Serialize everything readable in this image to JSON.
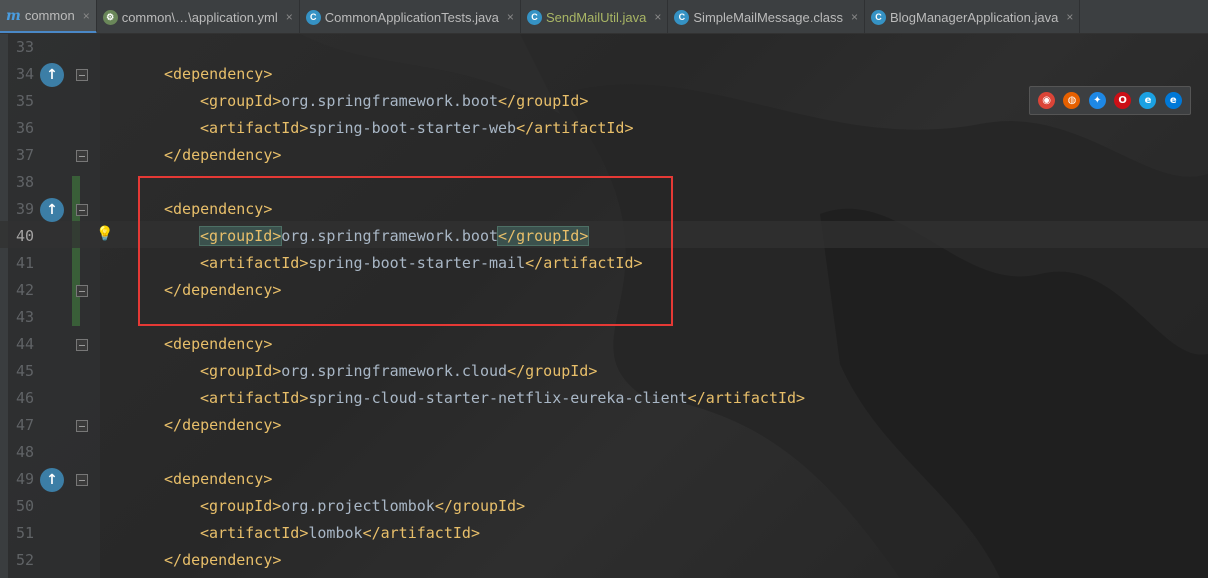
{
  "tabs": [
    {
      "label": "common",
      "icon": "maven-module-icon",
      "closable": true,
      "active": true
    },
    {
      "label": "common\\…\\application.yml",
      "icon": "yaml-file-icon",
      "closable": true,
      "active": false
    },
    {
      "label": "CommonApplicationTests.java",
      "icon": "java-class-icon",
      "closable": true,
      "active": false
    },
    {
      "label": "SendMailUtil.java",
      "icon": "java-class-icon",
      "closable": true,
      "active": false,
      "modified": true
    },
    {
      "label": "SimpleMailMessage.class",
      "icon": "class-file-icon",
      "closable": true,
      "active": false
    },
    {
      "label": "BlogManagerApplication.java",
      "icon": "java-class-icon",
      "closable": true,
      "active": false
    }
  ],
  "close_glyph": "×",
  "lines": [
    {
      "num": "33",
      "indent": 0,
      "kind": "blank"
    },
    {
      "num": "34",
      "indent": 1,
      "kind": "open",
      "tag": "dependency",
      "marker": true,
      "fold": true
    },
    {
      "num": "35",
      "indent": 2,
      "kind": "elem",
      "tag": "groupId",
      "text": "org.springframework.boot"
    },
    {
      "num": "36",
      "indent": 2,
      "kind": "elem",
      "tag": "artifactId",
      "text": "spring-boot-starter-web"
    },
    {
      "num": "37",
      "indent": 1,
      "kind": "close",
      "tag": "dependency",
      "fold": true
    },
    {
      "num": "38",
      "indent": 0,
      "kind": "blank"
    },
    {
      "num": "39",
      "indent": 1,
      "kind": "open",
      "tag": "dependency",
      "marker": true,
      "fold": true
    },
    {
      "num": "40",
      "indent": 2,
      "kind": "elem",
      "tag": "groupId",
      "text": "org.springframework.boot",
      "current": true,
      "bulb": true,
      "match": true
    },
    {
      "num": "41",
      "indent": 2,
      "kind": "elem",
      "tag": "artifactId",
      "text": "spring-boot-starter-mail"
    },
    {
      "num": "42",
      "indent": 1,
      "kind": "close",
      "tag": "dependency",
      "fold": true
    },
    {
      "num": "43",
      "indent": 0,
      "kind": "blank"
    },
    {
      "num": "44",
      "indent": 1,
      "kind": "open",
      "tag": "dependency",
      "fold": true
    },
    {
      "num": "45",
      "indent": 2,
      "kind": "elem",
      "tag": "groupId",
      "text": "org.springframework.cloud"
    },
    {
      "num": "46",
      "indent": 2,
      "kind": "elem",
      "tag": "artifactId",
      "text": "spring-cloud-starter-netflix-eureka-client"
    },
    {
      "num": "47",
      "indent": 1,
      "kind": "close",
      "tag": "dependency",
      "fold": true
    },
    {
      "num": "48",
      "indent": 0,
      "kind": "blank"
    },
    {
      "num": "49",
      "indent": 1,
      "kind": "open",
      "tag": "dependency",
      "marker": true,
      "fold": true
    },
    {
      "num": "50",
      "indent": 2,
      "kind": "elem",
      "tag": "groupId",
      "text": "org.projectlombok"
    },
    {
      "num": "51",
      "indent": 2,
      "kind": "elem",
      "tag": "artifactId",
      "text": "lombok"
    },
    {
      "num": "52",
      "indent": 1,
      "kind": "close",
      "tag": "dependency"
    }
  ],
  "browsers": [
    {
      "name": "chrome-icon",
      "color": "#db4437",
      "glyph": "◉"
    },
    {
      "name": "firefox-icon",
      "color": "#e66000",
      "glyph": "◍"
    },
    {
      "name": "safari-icon",
      "color": "#1e88e5",
      "glyph": "✦"
    },
    {
      "name": "opera-icon",
      "color": "#cc0f16",
      "glyph": "O"
    },
    {
      "name": "ie-icon",
      "color": "#1ba1e2",
      "glyph": "e"
    },
    {
      "name": "edge-icon",
      "color": "#0078d7",
      "glyph": "e"
    }
  ],
  "colors": {
    "tag": "#e8bf6a",
    "text": "#a9b7c6",
    "highlight_box": "#e53935",
    "vcs_added": "#395e38"
  }
}
